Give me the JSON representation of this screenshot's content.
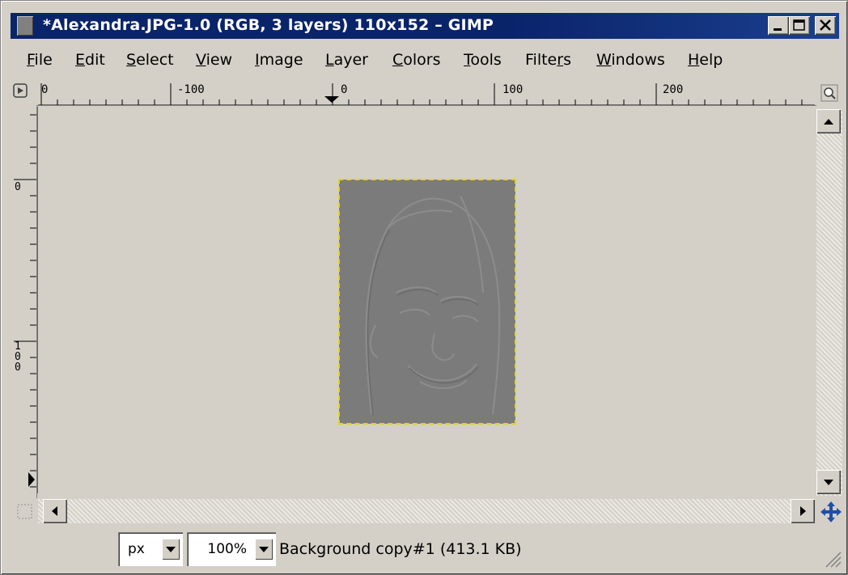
{
  "window": {
    "title": "*Alexandra.JPG-1.0 (RGB, 3 layers) 110x152 – GIMP",
    "controls": [
      "minimize-icon",
      "maximize-icon",
      "close-icon"
    ]
  },
  "menu": [
    {
      "label": "File",
      "mnemonic": "F",
      "rest": "ile"
    },
    {
      "label": "Edit",
      "mnemonic": "E",
      "rest": "dit"
    },
    {
      "label": "Select",
      "mnemonic": "S",
      "rest": "elect"
    },
    {
      "label": "View",
      "mnemonic": "V",
      "rest": "iew"
    },
    {
      "label": "Image",
      "mnemonic": "I",
      "rest": "mage"
    },
    {
      "label": "Layer",
      "mnemonic": "L",
      "rest": "ayer"
    },
    {
      "label": "Colors",
      "mnemonic": "C",
      "rest": "olors"
    },
    {
      "label": "Tools",
      "mnemonic": "T",
      "rest": "ools"
    },
    {
      "label": "Filters",
      "pre": "Filte",
      "mnemonic": "r",
      "rest": "s"
    },
    {
      "label": "Windows",
      "mnemonic": "W",
      "rest": "indows"
    },
    {
      "label": "Help",
      "mnemonic": "H",
      "rest": "elp"
    }
  ],
  "rulers": {
    "horizontal_labels": [
      "0",
      "-100",
      "0",
      "100",
      "200"
    ],
    "vertical_labels": [
      "0",
      "100"
    ]
  },
  "canvas": {
    "background": "#d4d0c8",
    "image_fill": "#7a7a7a",
    "selection_color": "#e6d600"
  },
  "status": {
    "unit": "px",
    "zoom": "100%",
    "info": "Background copy#1 (413.1 KB)"
  },
  "icons": {
    "menu_toggle": "triangle-right-icon",
    "zoom_toggle": "magnifier-icon",
    "quick_mask": "quick-mask-icon",
    "navigate": "navigate-icon",
    "resize": "resize-grip-icon"
  }
}
